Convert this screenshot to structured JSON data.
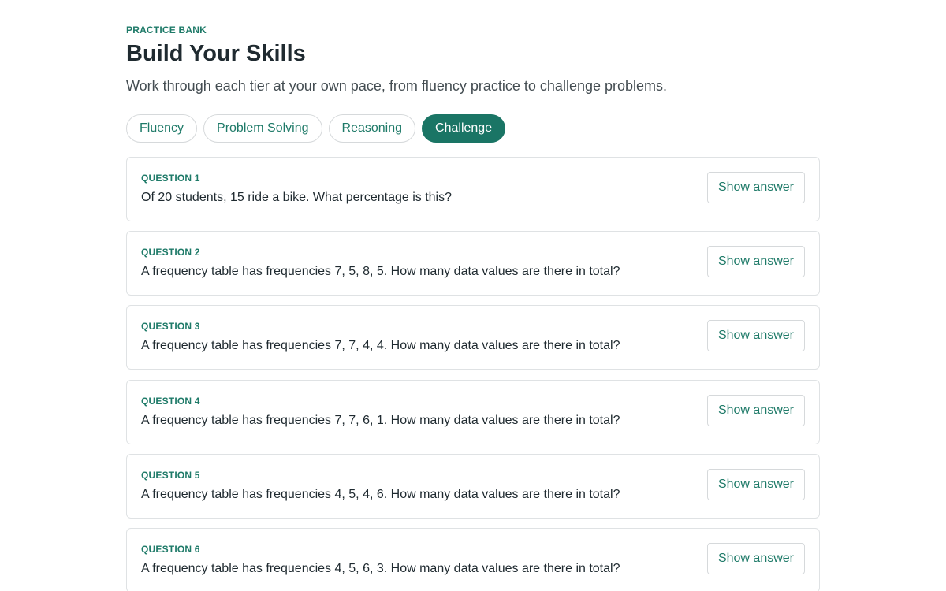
{
  "header": {
    "eyebrow": "PRACTICE BANK",
    "title": "Build Your Skills",
    "subtitle": "Work through each tier at your own pace, from fluency practice to challenge problems."
  },
  "tabs": [
    {
      "label": "Fluency",
      "active": false
    },
    {
      "label": "Problem Solving",
      "active": false
    },
    {
      "label": "Reasoning",
      "active": false
    },
    {
      "label": "Challenge",
      "active": true
    }
  ],
  "questions": [
    {
      "number": "QUESTION 1",
      "text": "Of 20 students, 15 ride a bike. What percentage is this?",
      "button": "Show answer"
    },
    {
      "number": "QUESTION 2",
      "text": "A frequency table has frequencies 7, 5, 8, 5. How many data values are there in total?",
      "button": "Show answer"
    },
    {
      "number": "QUESTION 3",
      "text": "A frequency table has frequencies 7, 7, 4, 4. How many data values are there in total?",
      "button": "Show answer"
    },
    {
      "number": "QUESTION 4",
      "text": "A frequency table has frequencies 7, 7, 6, 1. How many data values are there in total?",
      "button": "Show answer"
    },
    {
      "number": "QUESTION 5",
      "text": "A frequency table has frequencies 4, 5, 4, 6. How many data values are there in total?",
      "button": "Show answer"
    },
    {
      "number": "QUESTION 6",
      "text": "A frequency table has frequencies 4, 5, 6, 3. How many data values are there in total?",
      "button": "Show answer"
    }
  ],
  "colors": {
    "accent": "#1e7a68",
    "accent_fill": "#1a7565",
    "border": "#dfe2e4",
    "text": "#1f2a30"
  }
}
